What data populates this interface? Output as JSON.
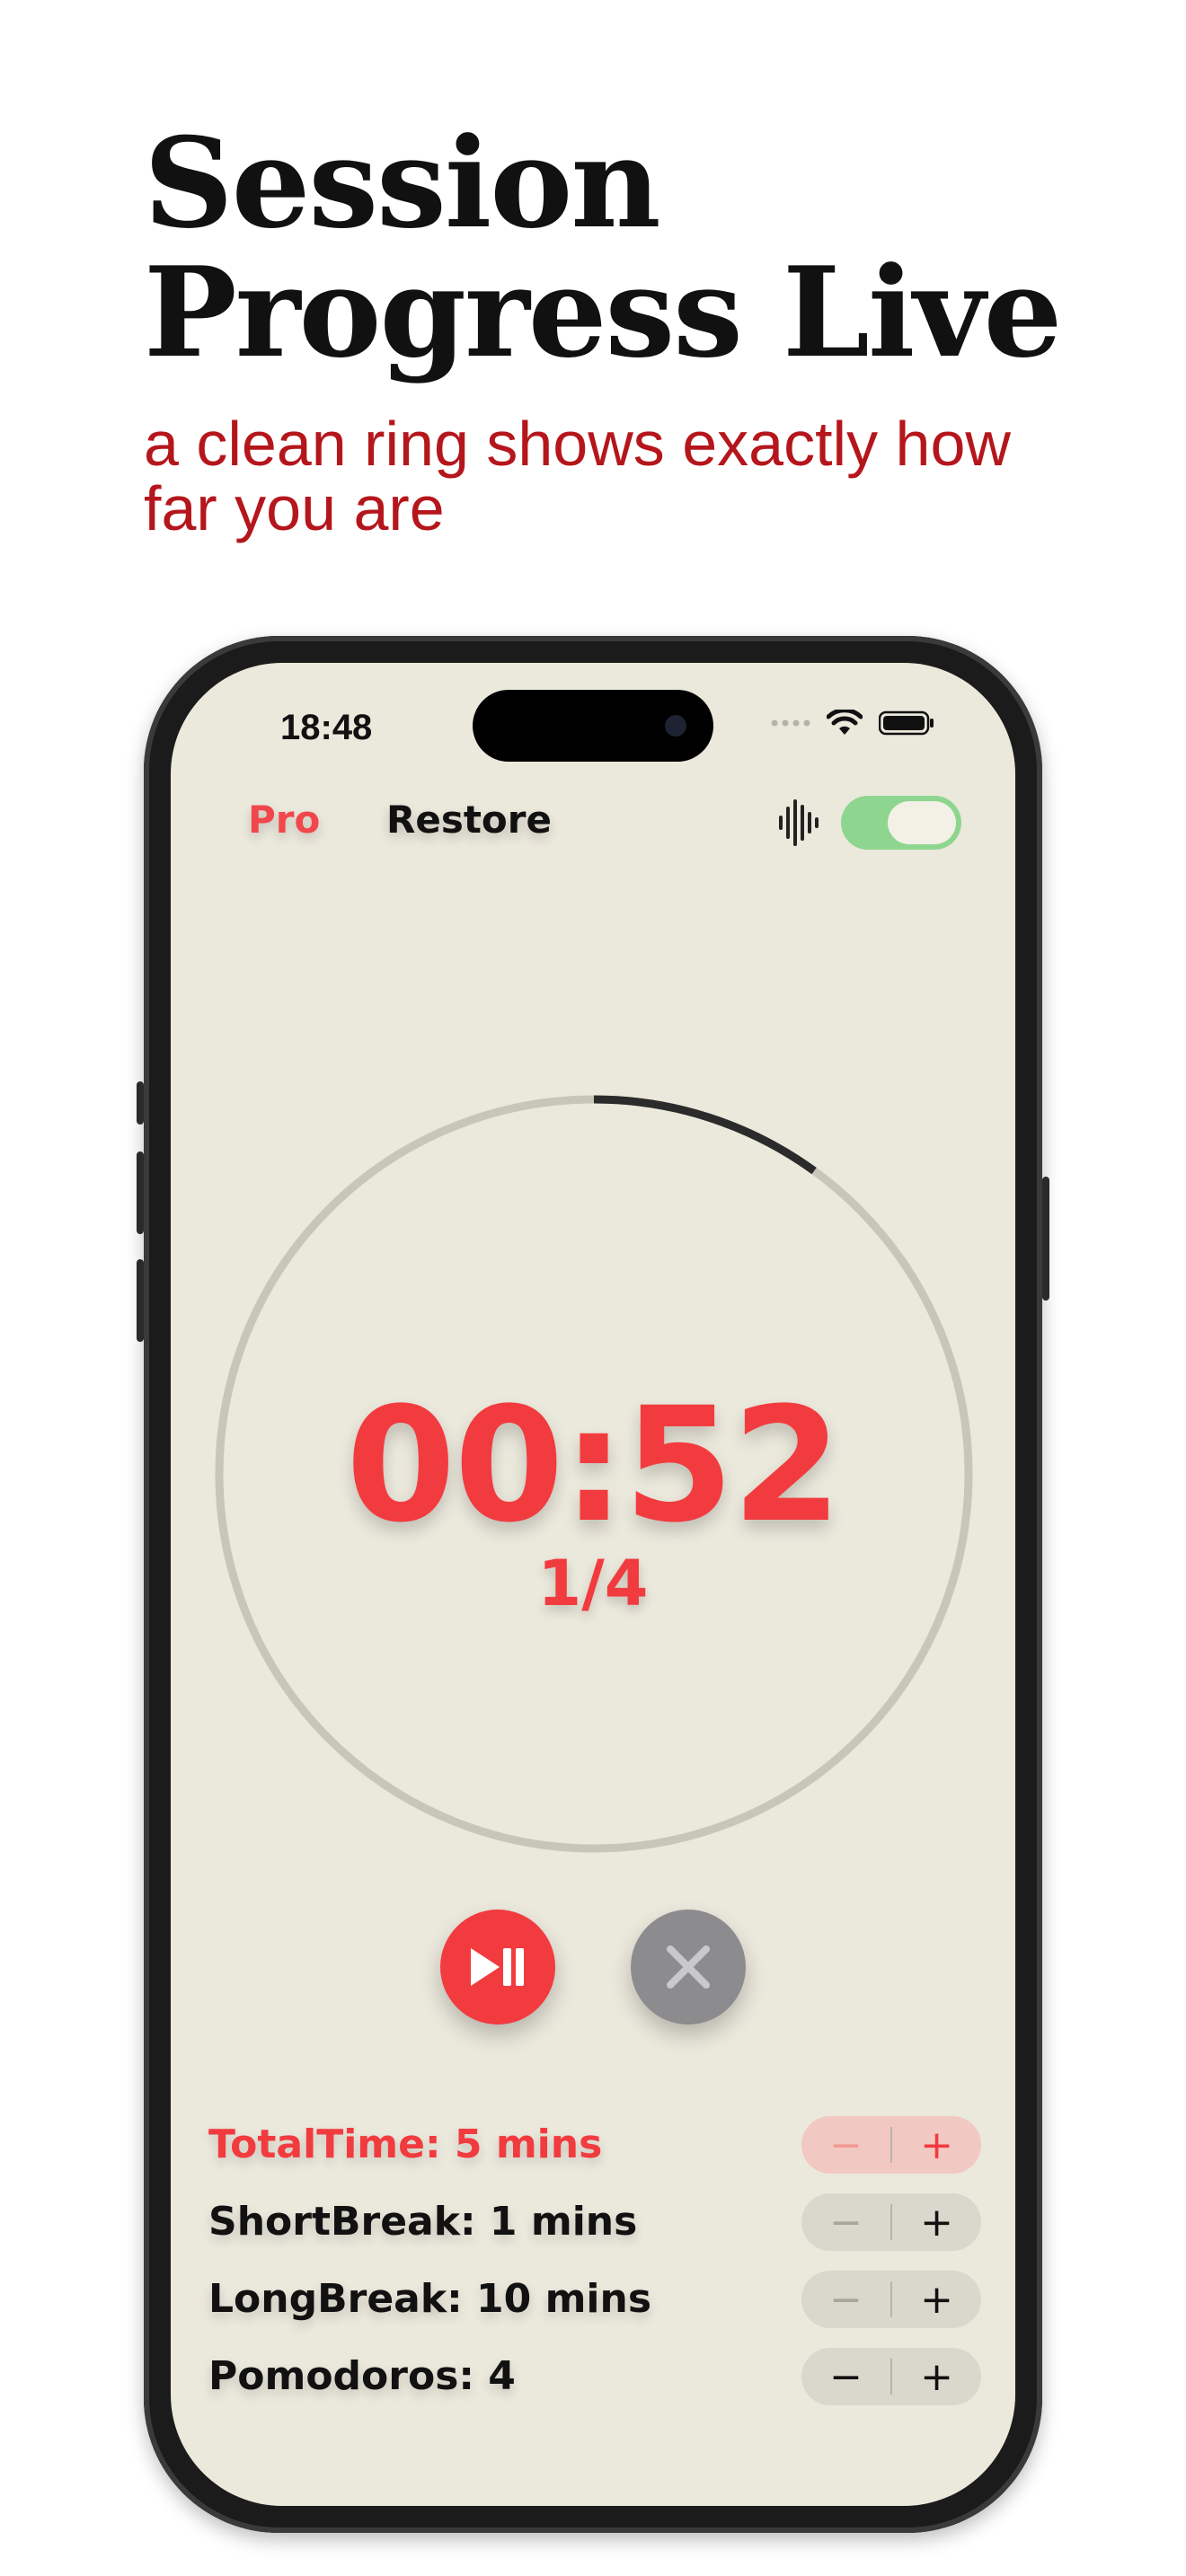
{
  "headline": {
    "title_line1": "Session",
    "title_line2": "Progress Live",
    "subtitle": "a clean ring shows exactly how far you are"
  },
  "status_bar": {
    "time": "18:48",
    "icons": [
      "signal-dots-icon",
      "wifi-icon",
      "battery-icon"
    ]
  },
  "top_bar": {
    "pro_label": "Pro",
    "restore_label": "Restore",
    "sound_icon": "waveform-icon",
    "sound_toggle_on": true
  },
  "timer": {
    "time": "00:52",
    "round": "1/4",
    "progress_fraction": 0.1
  },
  "controls": {
    "play_pause_icon": "play-pause-icon",
    "cancel_icon": "close-icon"
  },
  "settings": [
    {
      "label": "TotalTime: 5 mins",
      "minus": "−",
      "plus": "+"
    },
    {
      "label": "ShortBreak: 1 mins",
      "minus": "−",
      "plus": "+"
    },
    {
      "label": "LongBreak: 10 mins",
      "minus": "−",
      "plus": "+"
    },
    {
      "label": "Pomodoros: 4",
      "minus": "−",
      "plus": "+"
    }
  ],
  "colors": {
    "accent_red": "#f23b3f",
    "subtitle_red": "#b5161c",
    "screen_bg": "#ebe8dc",
    "toggle_green": "#8ed68f",
    "ring_track": "#c8c6b8",
    "ring_progress": "#2b2b2b"
  }
}
